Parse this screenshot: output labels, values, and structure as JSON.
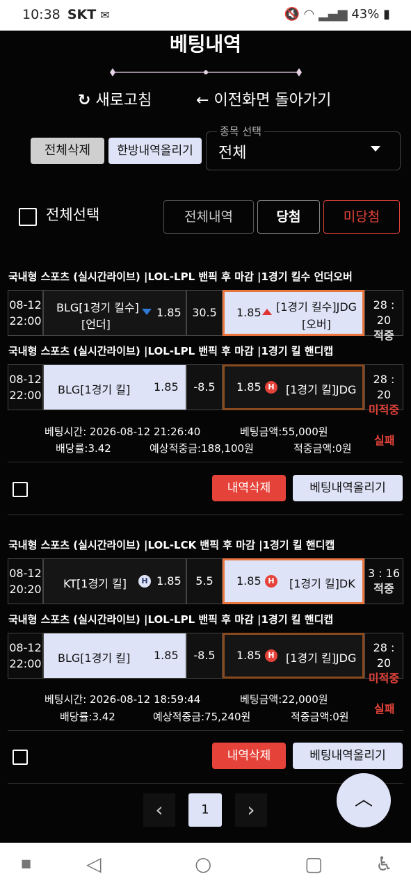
{
  "status_bar": {
    "time": "10:38",
    "carrier": "SKT",
    "battery": "43%"
  },
  "header": {
    "title": "베팅내역",
    "refresh_label": "새로고침",
    "back_label": "이전화면 돌아가기"
  },
  "toolbar": {
    "delete_all_label": "전체삭제",
    "upload_batch_label": "한방내역올리기",
    "sport_select_legend": "종목 선택",
    "sport_select_value": "전체"
  },
  "filters": {
    "select_all_label": "전체선택",
    "all_history_label": "전체내역",
    "won_label": "당첨",
    "unsettled_label": "미당첨"
  },
  "bets": [
    {
      "games": [
        {
          "header": "국내형 스포츠 (실시간라이브) |LOL-LPL 밴픽 후 마감 |1경기 킬수 언더오버",
          "date": "08-12",
          "time": "22:00",
          "left_label_1": "BLG[1경기 킬수]",
          "left_label_2": "[언더]",
          "left_odds": "1.85",
          "middle": "30.5",
          "right_odds": "1.85",
          "right_label_1": "[1경기 킬수]JDG",
          "right_label_2": "[오버]",
          "score": "28 : 20",
          "status": "적중"
        },
        {
          "header": "국내형 스포츠 (실시간라이브) |LOL-LPL 밴픽 후 마감 |1경기 킬 핸디캡",
          "date": "08-12",
          "time": "22:00",
          "left_label_1": "BLG[1경기 킬]",
          "left_odds": "1.85",
          "middle": "-8.5",
          "right_odds": "1.85",
          "right_label_1": "[1경기 킬]JDG",
          "handicap_badge": "H",
          "score": "28 : 20",
          "status": "미적중"
        }
      ],
      "bet_time": "베팅시간: 2026-08-12 21:26:40",
      "bet_amount": "베팅금액:55,000원",
      "odds_total": "배당률:3.42",
      "expected_win": "예상적중금:188,100원",
      "hit_amount": "적중금액:0원",
      "result": "실패",
      "delete_label": "내역삭제",
      "upload_label": "베팅내역올리기"
    },
    {
      "games": [
        {
          "header": "국내형 스포츠 (실시간라이브) |LOL-LCK 밴픽 후 마감 |1경기 킬 핸디캡",
          "date": "08-12",
          "time": "20:20",
          "left_label_1": "KT[1경기 킬]",
          "left_odds": "1.85",
          "left_badge": "H",
          "middle": "5.5",
          "right_odds": "1.85",
          "right_label_1": "[1경기 킬]DK",
          "handicap_badge": "H",
          "score": "3 : 16",
          "status": "적중"
        },
        {
          "header": "국내형 스포츠 (실시간라이브) |LOL-LPL 밴픽 후 마감 |1경기 킬 핸디캡",
          "date": "08-12",
          "time": "22:00",
          "left_label_1": "BLG[1경기 킬]",
          "left_odds": "1.85",
          "middle": "-8.5",
          "right_odds": "1.85",
          "right_label_1": "[1경기 킬]JDG",
          "handicap_badge": "H",
          "score": "28 : 20",
          "status": "미적중"
        }
      ],
      "bet_time": "베팅시간: 2026-08-12 18:59:44",
      "bet_amount": "베팅금액:22,000원",
      "odds_total": "배당률:3.42",
      "expected_win": "예상적중금:75,240원",
      "hit_amount": "적중금액:0원",
      "result": "실패",
      "delete_label": "내역삭제",
      "upload_label": "베팅내역올리기"
    }
  ],
  "pagination": {
    "prev": "‹",
    "current": "1",
    "next": "›"
  },
  "scroll_top_icon": "chevron-up-icon",
  "colors": {
    "accent_red": "#e5433a",
    "highlight": "#dfe3f7",
    "win_outline": "#e9753f",
    "loss_outline": "#8a4a1f"
  }
}
